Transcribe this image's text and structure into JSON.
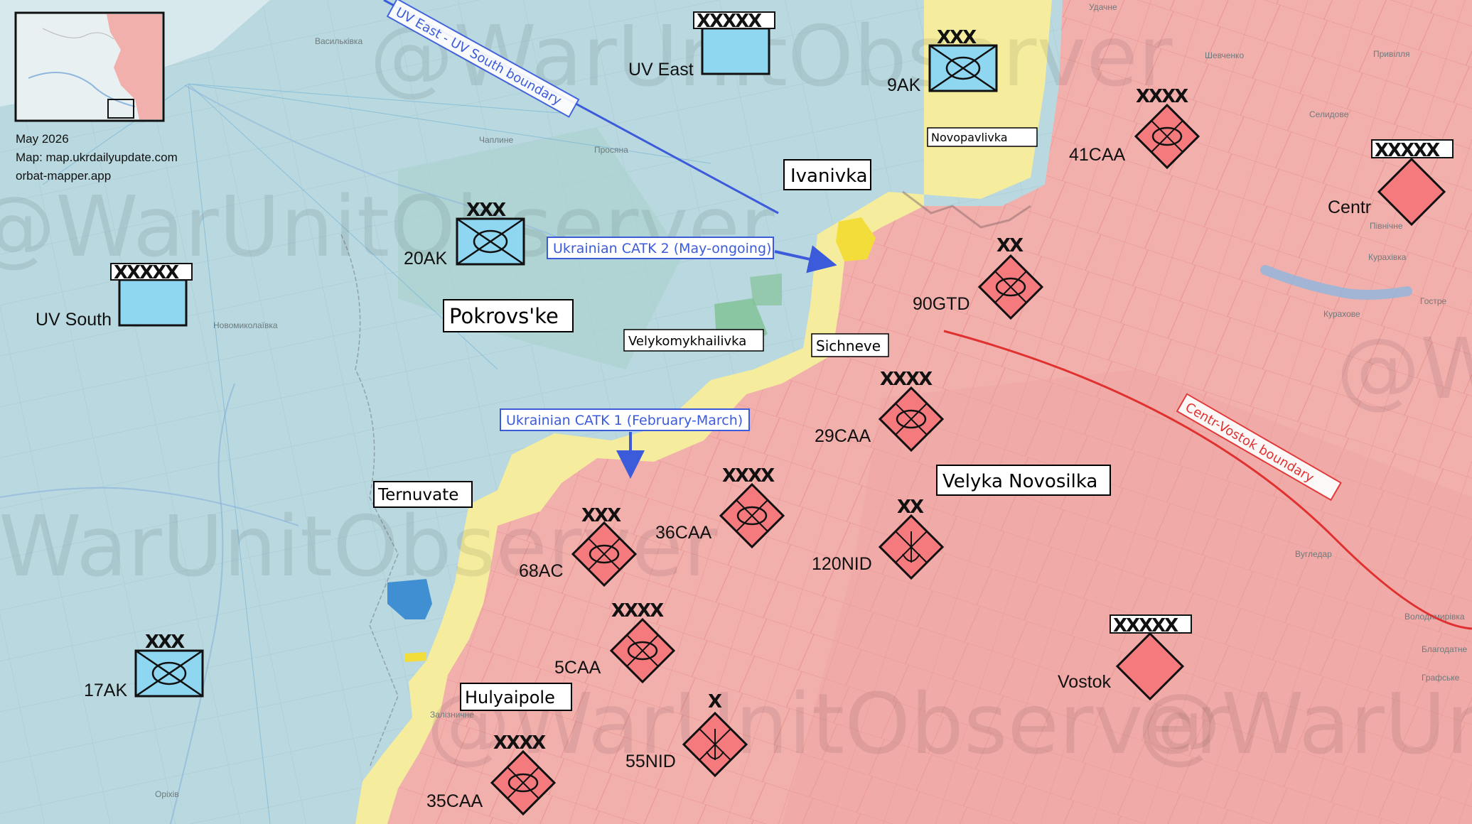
{
  "credits": {
    "date": "May 2026",
    "map_source": "Map: map.ukrdailyupdate.com",
    "tool": "orbat-mapper.app"
  },
  "watermark": "@WarUnitObserver",
  "colors": {
    "ukraine_controlled": "#b9d8df",
    "russia_controlled": "#f2b0ad",
    "contested": "#f5ec9d",
    "russian_unit": "#f47a7d",
    "ukrainian_unit": "#8fd6f1",
    "ukrainian_label": "#3b5bdb",
    "russian_boundary": "#e03131"
  },
  "towns": {
    "ivanivka": "Ivanivka",
    "novopavlivka": "Novopavlivka",
    "pokrovske": "Pokrovs'ke",
    "velykomykhailivka": "Velykomykhailivka",
    "sichneve": "Sichneve",
    "ternuvate": "Ternuvate",
    "hulyaipole": "Hulyaipole",
    "velyka_novosilka": "Velyka Novosilka"
  },
  "background_places": {
    "vasylkivka": "Васильківка",
    "chaplyne": "Чаплине",
    "prosiana": "Просяна",
    "novomykolaivka": "Новомиколаївка",
    "zaliznychne": "Залізничне",
    "orikhiv": "Оріхів",
    "udachne": "Удачне",
    "shevchenko": "Шевченко",
    "selydove": "Селидове",
    "pryvillia": "Привілля",
    "kurakhivka": "Курахівка",
    "kurakhove": "Курахове",
    "vuhledar": "Вугледар",
    "volodymyrivka": "Володимирівка",
    "blahodatne": "Благодатне",
    "hrafske": "Графське",
    "hostre": "Гостре",
    "pivnichne": "Північне"
  },
  "annotations": {
    "catk2": "Ukrainian CATK 2 (May-ongoing)",
    "catk1": "Ukrainian CATK 1 (February-March)",
    "uv_boundary": "UV East - UV South boundary",
    "centr_vostok_boundary": "Centr-Vostok boundary"
  },
  "ukrainian_units": [
    {
      "name": "UV East",
      "echelon": "XXXXX",
      "icon": "ua-army-group-icon"
    },
    {
      "name": "9AK",
      "echelon": "XXX",
      "icon": "ua-corps-infantry-icon"
    },
    {
      "name": "20AK",
      "echelon": "XXX",
      "icon": "ua-corps-infantry-icon"
    },
    {
      "name": "UV South",
      "echelon": "XXXXX",
      "icon": "ua-army-group-icon"
    },
    {
      "name": "17AK",
      "echelon": "XXX",
      "icon": "ua-corps-infantry-icon"
    }
  ],
  "russian_units": [
    {
      "name": "41CAA",
      "echelon": "XXXX",
      "icon": "ru-army-infantry-icon"
    },
    {
      "name": "Centr",
      "echelon": "XXXXX",
      "icon": "ru-army-group-icon"
    },
    {
      "name": "90GTD",
      "echelon": "XX",
      "icon": "ru-division-tank-icon"
    },
    {
      "name": "29CAA",
      "echelon": "XXXX",
      "icon": "ru-army-infantry-icon"
    },
    {
      "name": "36CAA",
      "echelon": "XXXX",
      "icon": "ru-army-infantry-icon"
    },
    {
      "name": "68AC",
      "echelon": "XXX",
      "icon": "ru-corps-infantry-icon"
    },
    {
      "name": "120NID",
      "echelon": "XX",
      "icon": "ru-division-airborne-icon"
    },
    {
      "name": "5CAA",
      "echelon": "XXXX",
      "icon": "ru-army-infantry-icon"
    },
    {
      "name": "55NID",
      "echelon": "X",
      "icon": "ru-brigade-airborne-icon"
    },
    {
      "name": "35CAA",
      "echelon": "XXXX",
      "icon": "ru-army-infantry-icon"
    },
    {
      "name": "Vostok",
      "echelon": "XXXXX",
      "icon": "ru-army-group-icon"
    }
  ]
}
